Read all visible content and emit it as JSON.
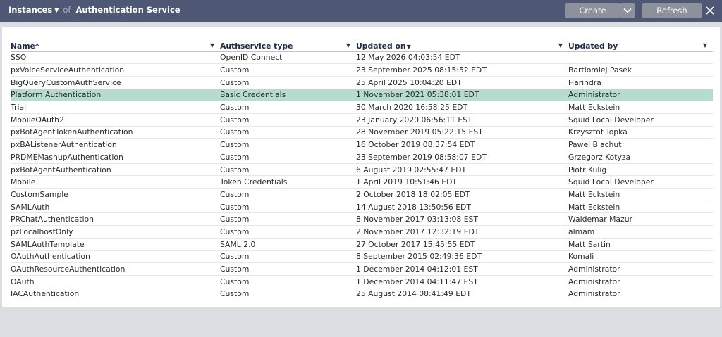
{
  "header": {
    "instances_label": "Instances",
    "of_label": "of",
    "service_label": "Authentication Service",
    "create_label": "Create",
    "refresh_label": "Refresh"
  },
  "table": {
    "columns": [
      "Name*",
      "Authservice type",
      "Updated on",
      "Updated by"
    ],
    "rows": [
      [
        "SSO",
        "OpenID Connect",
        "12 May 2026 04:03:54 EDT",
        ""
      ],
      [
        "pxVoiceServiceAuthentication",
        "Custom",
        "23 September 2025 08:15:52 EDT",
        "Bartlomiej Pasek"
      ],
      [
        "BigQueryCustomAuthService",
        "Custom",
        "25 April 2025 10:04:20 EDT",
        "Harindra"
      ],
      [
        "Platform Authentication",
        "Basic Credentials",
        "1 November 2021 05:38:01 EDT",
        "Administrator"
      ],
      [
        "Trial",
        "Custom",
        "30 March 2020 16:58:25 EDT",
        "Matt Eckstein"
      ],
      [
        "MobileOAuth2",
        "Custom",
        "23 January 2020 06:56:11 EST",
        "Squid Local Developer"
      ],
      [
        "pxBotAgentTokenAuthentication",
        "Custom",
        "28 November 2019 05:22:15 EST",
        "Krzysztof Topka"
      ],
      [
        "pxBAListenerAuthentication",
        "Custom",
        "16 October 2019 08:37:54 EDT",
        "Pawel Blachut"
      ],
      [
        "PRDMEMashupAuthentication",
        "Custom",
        "23 September 2019 08:58:07 EDT",
        "Grzegorz Kotyza"
      ],
      [
        "pxBotAgentAuthentication",
        "Custom",
        "6 August 2019 02:55:47 EDT",
        "Piotr Kulig"
      ],
      [
        "Mobile",
        "Token Credentials",
        "1 April 2019 10:51:46 EDT",
        "Squid Local Developer"
      ],
      [
        "CustomSample",
        "Custom",
        "2 October 2018 18:02:05 EDT",
        "Matt Eckstein"
      ],
      [
        "SAMLAuth",
        "Custom",
        "14 August 2018 13:50:56 EDT",
        "Matt Eckstein"
      ],
      [
        "PRChatAuthentication",
        "Custom",
        "8 November 2017 03:13:08 EST",
        "Waldemar Mazur"
      ],
      [
        "pzLocalhostOnly",
        "Custom",
        "2 November 2017 12:32:19 EDT",
        "almam"
      ],
      [
        "SAMLAuthTemplate",
        "SAML 2.0",
        "27 October 2017 15:45:55 EDT",
        "Matt Sartin"
      ],
      [
        "OAuthAuthentication",
        "Custom",
        "8 September 2015 02:49:36 EDT",
        "Komali"
      ],
      [
        "OAuthResourceAuthentication",
        "Custom",
        "1 December 2014 04:12:01 EST",
        "Administrator"
      ],
      [
        "OAuth",
        "Custom",
        "1 December 2014 04:11:47 EST",
        "Administrator"
      ],
      [
        "IACAuthentication",
        "Custom",
        "25 August 2014 08:41:49 EDT",
        "Administrator"
      ]
    ],
    "selected_index": 3
  }
}
